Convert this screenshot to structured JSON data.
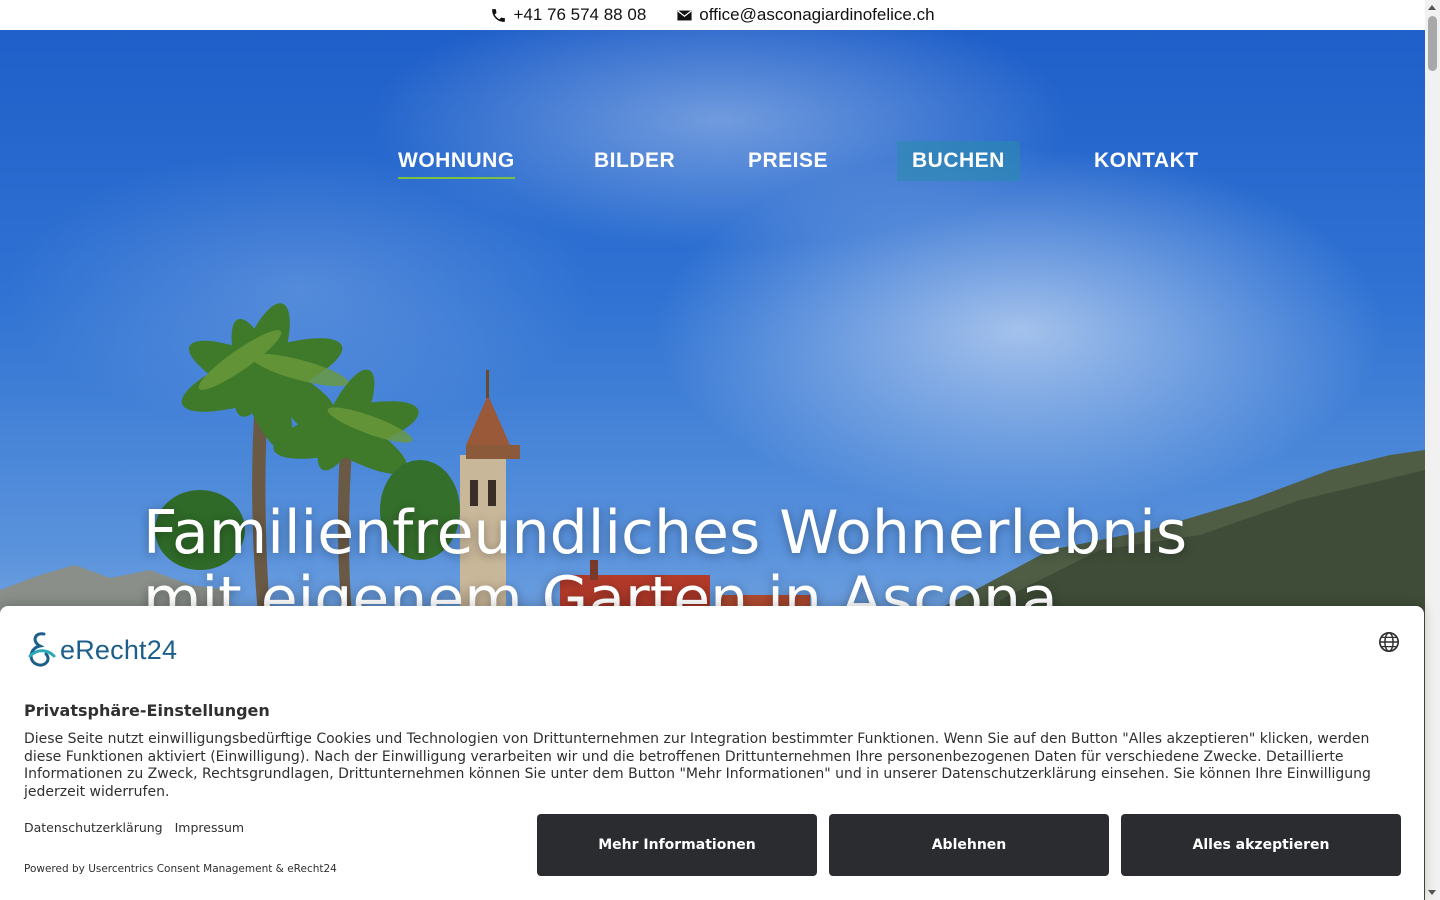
{
  "topbar": {
    "phone": "+41 76 574 88 08",
    "email": "office@asconagiardinofelice.ch"
  },
  "nav": {
    "items": [
      {
        "label": "WOHNUNG",
        "active": true
      },
      {
        "label": "BILDER"
      },
      {
        "label": "PREISE"
      },
      {
        "label": "BUCHEN",
        "highlighted": true
      },
      {
        "label": "KONTAKT"
      }
    ]
  },
  "hero": {
    "headline": "Familienfreundliches Wohnerlebnis mit eigenem Garten in Ascona"
  },
  "consent": {
    "logo_text": "eRecht24",
    "title": "Privatsphäre-Einstellungen",
    "description": "Diese Seite nutzt einwilligungsbedürftige Cookies und Technologien von Drittunternehmen zur Integration bestimmter Funktionen. Wenn Sie auf den Button \"Alles akzeptieren\" klicken, werden diese Funktionen aktiviert (Einwilligung). Nach der Einwilligung verarbeiten wir und die betroffenen Drittunternehmen Ihre personenbezogenen Daten für verschiedene Zwecke. Detaillierte Informationen zu Zweck, Rechtsgrundlagen, Drittunternehmen können Sie unter dem Button \"Mehr Informationen\" und in unserer Datenschutzerklärung einsehen. Sie können Ihre Einwilligung jederzeit widerrufen.",
    "links": {
      "privacy": "Datenschutzerklärung",
      "imprint": "Impressum"
    },
    "powered_by": "Powered by Usercentrics Consent Management & eRecht24",
    "buttons": {
      "more": "Mehr Informationen",
      "deny": "Ablehnen",
      "accept": "Alles akzeptieren"
    }
  },
  "colors": {
    "button_bg": "#2a2c30",
    "nav_active_underline": "#7ac143",
    "brand_blue": "#1d5f8c"
  },
  "icons": {
    "phone": "phone-icon",
    "email": "envelope-icon",
    "language": "globe-icon"
  }
}
